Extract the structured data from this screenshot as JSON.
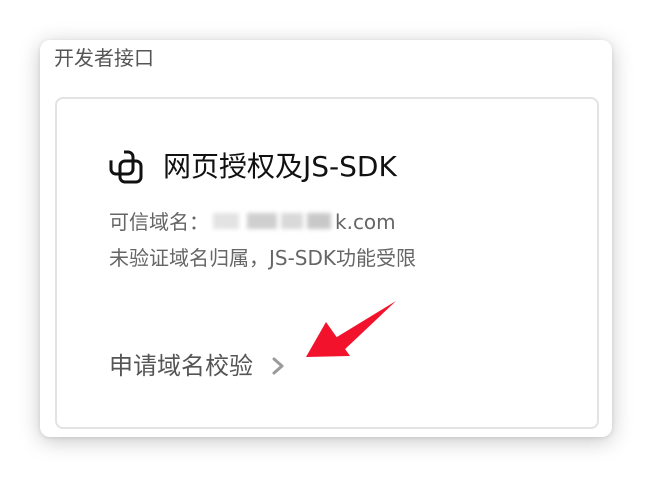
{
  "section": {
    "title": "开发者接口"
  },
  "card": {
    "icon": "copy-icon",
    "title": "网页授权及JS-SDK",
    "trusted_domain_label": "可信域名：",
    "trusted_domain_visible_suffix": "k.com",
    "warning": "未验证域名归属，JS-SDK功能受限",
    "action_label": "申请域名校验",
    "action_icon": "chevron-right-icon"
  },
  "annotation": {
    "type": "arrow",
    "color": "#f2122b"
  }
}
